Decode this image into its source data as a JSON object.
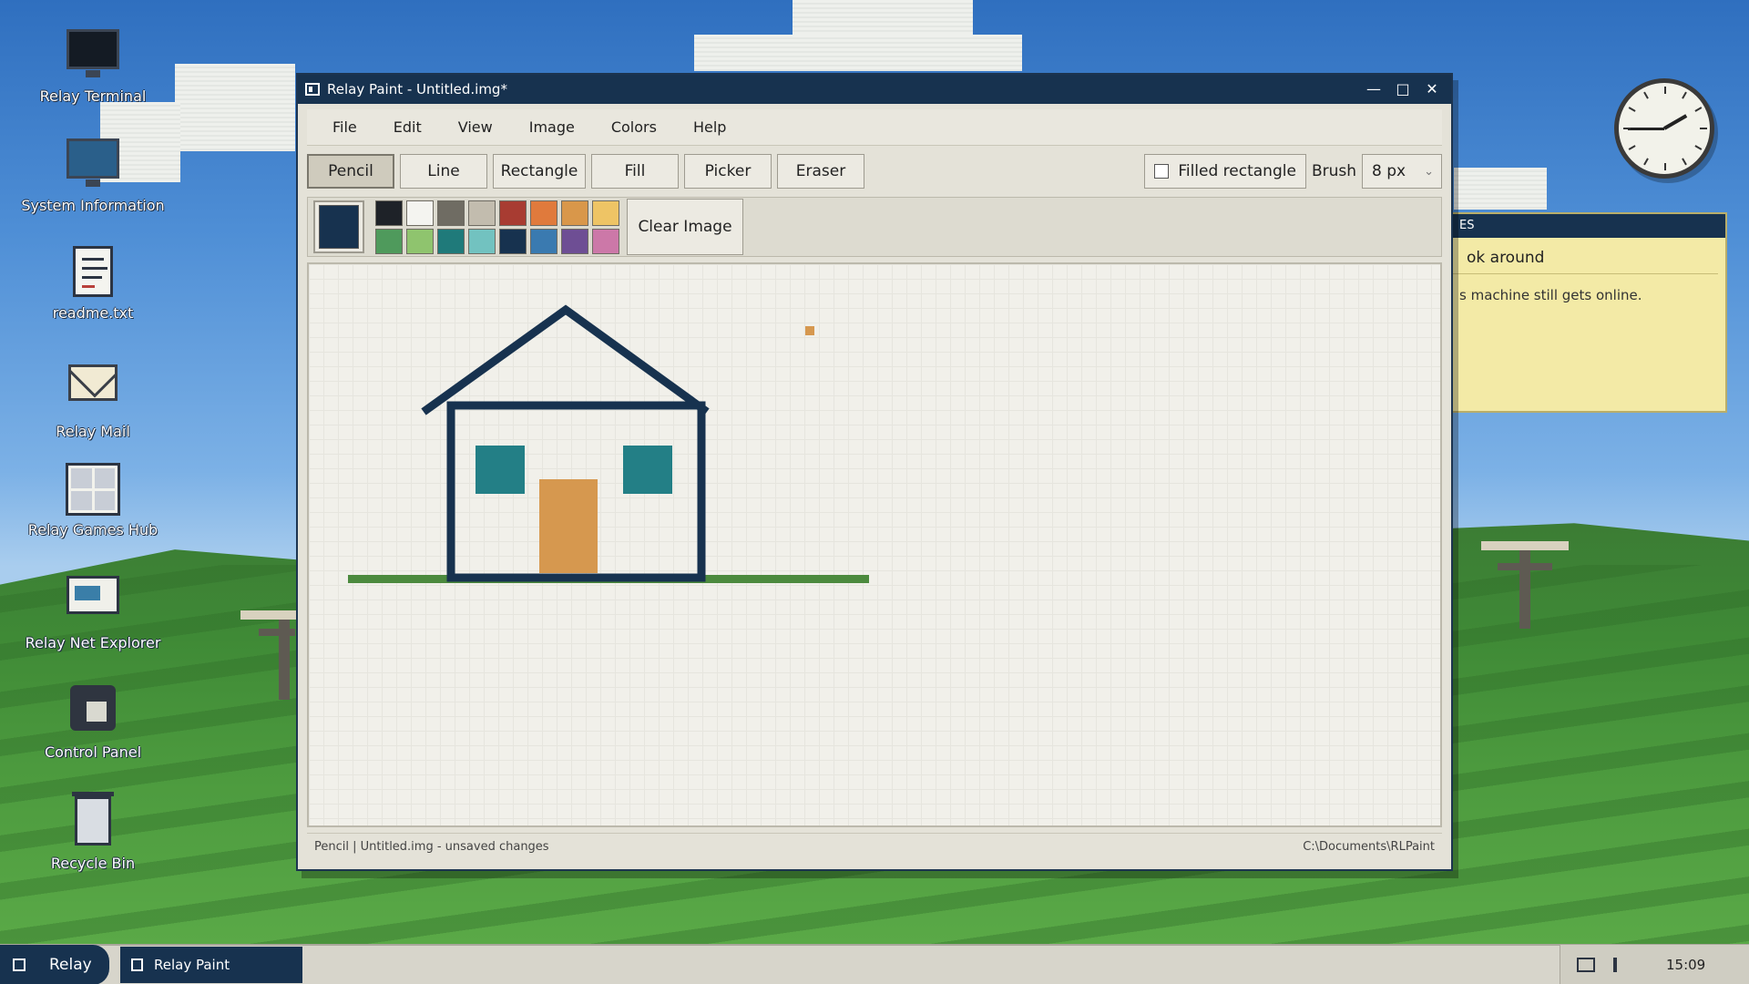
{
  "desktop": {
    "icons": [
      {
        "label": "Relay Terminal",
        "icon": "terminal-icon"
      },
      {
        "label": "System Information",
        "icon": "system-info-icon"
      },
      {
        "label": "readme.txt",
        "icon": "text-file-icon"
      },
      {
        "label": "Relay Mail",
        "icon": "mail-icon"
      },
      {
        "label": "Relay Games Hub",
        "icon": "games-hub-icon"
      },
      {
        "label": "Relay Net Explorer",
        "icon": "net-explorer-icon"
      },
      {
        "label": "Control Panel",
        "icon": "control-panel-icon"
      },
      {
        "label": "Recycle Bin",
        "icon": "recycle-bin-icon"
      }
    ]
  },
  "notes": {
    "header": "ES",
    "line1": "ok around",
    "line2": "s machine still gets online."
  },
  "window": {
    "title": "Relay Paint - Untitled.img*",
    "menu": [
      "File",
      "Edit",
      "View",
      "Image",
      "Colors",
      "Help"
    ],
    "tools": [
      "Pencil",
      "Line",
      "Rectangle",
      "Fill",
      "Picker",
      "Eraser"
    ],
    "active_tool": "Pencil",
    "filled_rectangle_label": "Filled rectangle",
    "filled_rectangle_checked": false,
    "brush_label": "Brush",
    "brush_size": "8 px",
    "current_color": "#17324f",
    "palette": [
      "#1e2228",
      "#f4f4f0",
      "#6f6c63",
      "#c2bcae",
      "#a83c32",
      "#e07a3c",
      "#d9974a",
      "#eec465",
      "#4f9a5c",
      "#8fc46e",
      "#1f7a7a",
      "#72c2c0",
      "#17324f",
      "#3a7ab0",
      "#6e4e94",
      "#cc78a8"
    ],
    "clear_label": "Clear Image",
    "status_left": "Pencil | Untitled.img - unsaved changes",
    "status_right": "C:\\Documents\\RLPaint"
  },
  "drawing_colors": {
    "outline": "#17324f",
    "window_fill": "#237f86",
    "door_fill": "#d6984f",
    "ground": "#4c8a3e",
    "dot": "#d6984f"
  },
  "taskbar": {
    "start_label": "Relay",
    "task_label": "Relay Paint",
    "time": "15:09"
  }
}
